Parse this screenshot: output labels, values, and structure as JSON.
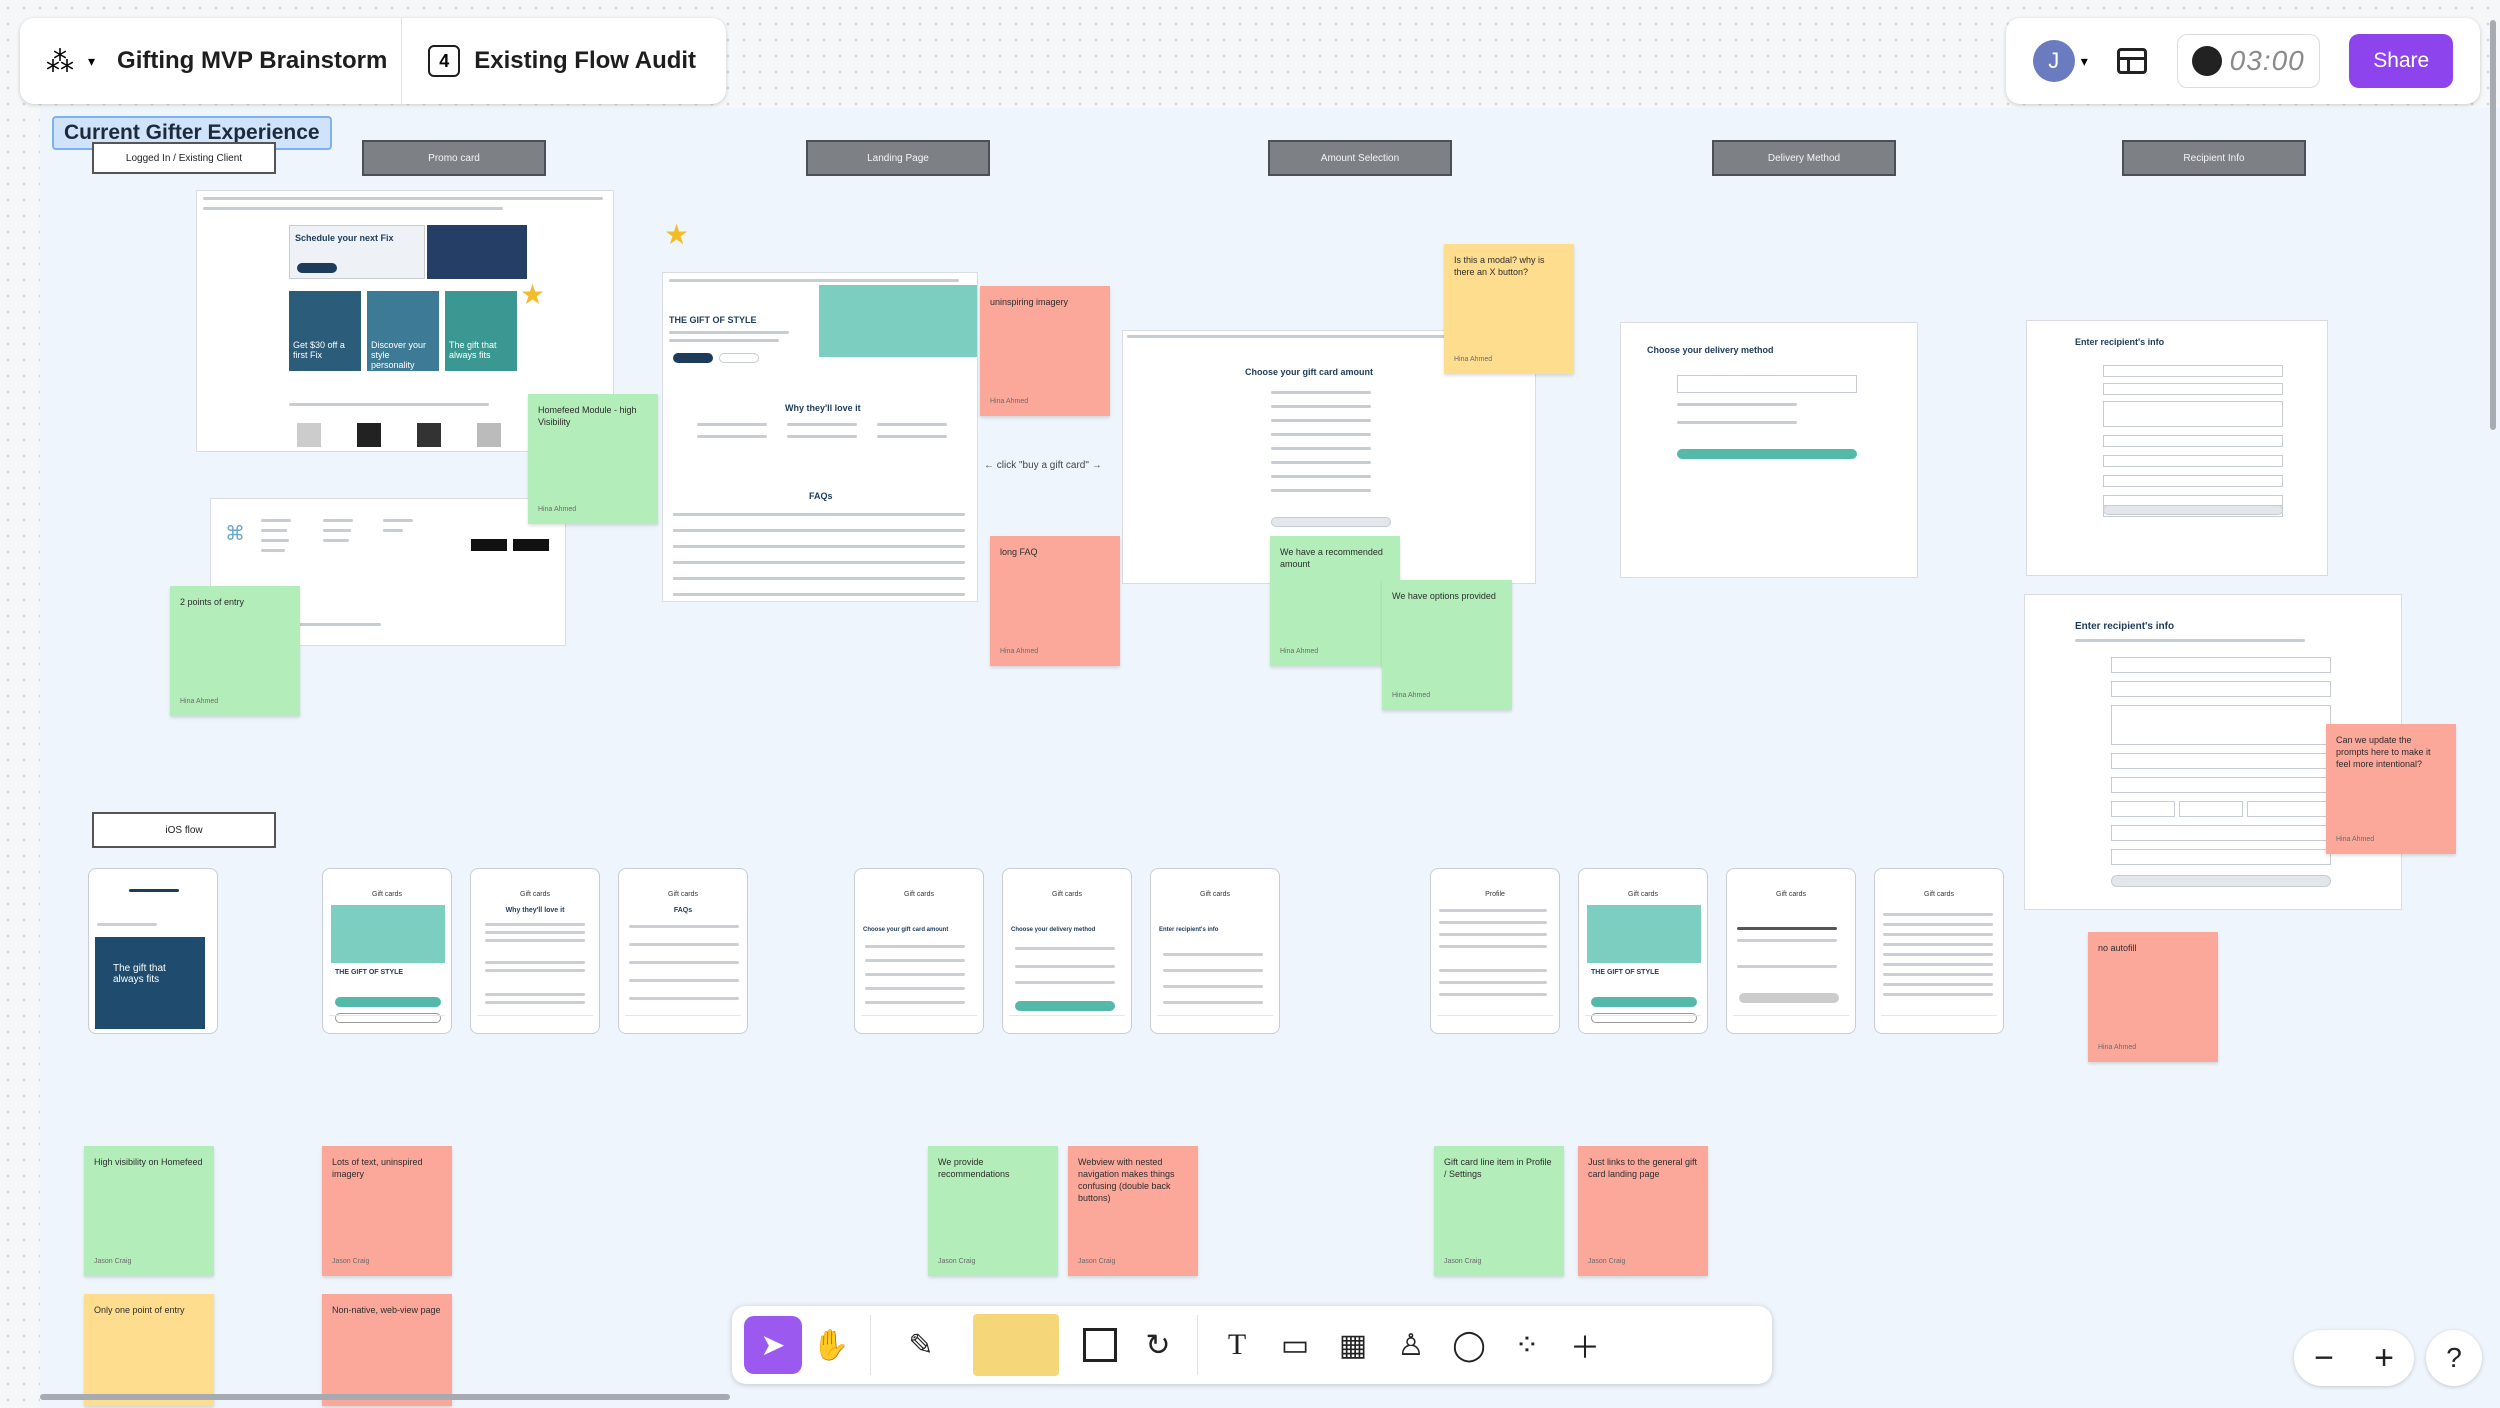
{
  "header": {
    "file_name": "Gifting MVP Brainstorm",
    "page_number": "4",
    "page_name": "Existing Flow Audit",
    "avatar_initial": "J",
    "timer": "03:00",
    "share_label": "Share"
  },
  "section": {
    "title": "Current Gifter Experience"
  },
  "columns": {
    "logged_in": "Logged In / Existing Client",
    "promo_card": "Promo card",
    "landing_page": "Landing Page",
    "amount_selection": "Amount Selection",
    "delivery_method": "Delivery Method",
    "recipient_info": "Recipient Info",
    "ios_flow": "iOS flow"
  },
  "screens": {
    "hero_title": "Schedule your next Fix",
    "gift_of_style": "THE GIFT OF STYLE",
    "why_love": "Why they'll love it",
    "faqs": "FAQs",
    "choose_amount": "Choose your gift card amount",
    "choose_delivery": "Choose your delivery method",
    "enter_recipient": "Enter recipient's info",
    "enter_recipient_2": "Enter recipient's info",
    "promo_1": "Get $30 off a first Fix",
    "promo_2": "Discover your style personality",
    "promo_3": "The gift that always fits",
    "ios_hero": "The gift that always fits",
    "ios_title_1": "Gift cards",
    "ios_title_2": "Profile",
    "ios_title_3": "Gift cards",
    "ios_title_4": "Gift cards"
  },
  "annotations": {
    "click_gift_card": "← click \"buy a gift card\" →"
  },
  "stickies": [
    {
      "text": "Homefeed Module - high Visibility",
      "author": "Hina Ahmed",
      "color": "green"
    },
    {
      "text": "2 points of entry",
      "author": "Hina Ahmed",
      "color": "green"
    },
    {
      "text": "uninspiring imagery",
      "author": "Hina Ahmed",
      "color": "red"
    },
    {
      "text": "long FAQ",
      "author": "Hina Ahmed",
      "color": "red"
    },
    {
      "text": "Is this a modal? why is there an X button?",
      "author": "Hina Ahmed",
      "color": "yellow"
    },
    {
      "text": "We have a recommended amount",
      "author": "Hina Ahmed",
      "color": "green"
    },
    {
      "text": "We have options provided",
      "author": "Hina Ahmed",
      "color": "green"
    },
    {
      "text": "Can we update the prompts here to make it feel more intentional?",
      "author": "Hina Ahmed",
      "color": "red"
    },
    {
      "text": "no autofill",
      "author": "Hina Ahmed",
      "color": "red"
    },
    {
      "text": "High visibility on Homefeed",
      "author": "Jason Craig",
      "color": "green"
    },
    {
      "text": "Lots of text, uninspired imagery",
      "author": "Jason Craig",
      "color": "red"
    },
    {
      "text": "We provide recommendations",
      "author": "Jason Craig",
      "color": "green"
    },
    {
      "text": "Webview with nested navigation makes things confusing (double back buttons)",
      "author": "Jason Craig",
      "color": "red"
    },
    {
      "text": "Gift card line item in Profile / Settings",
      "author": "Jason Craig",
      "color": "green"
    },
    {
      "text": "Just links to the general gift card landing page",
      "author": "Jason Craig",
      "color": "red"
    },
    {
      "text": "Only one point of entry",
      "author": "",
      "color": "yellow"
    },
    {
      "text": "Non-native, web-view page",
      "author": "",
      "color": "red"
    }
  ],
  "colors": {
    "accent": "#8e44ec",
    "sticky_green": "#b3edb9",
    "sticky_red": "#fba89b",
    "sticky_yellow": "#ffdd8e",
    "brand_teal": "#55b9a9"
  },
  "icons": {
    "app_menu": "figma-logo-icon",
    "layout": "layout-panel-icon",
    "tools": [
      "cursor-icon",
      "hand-icon",
      "pen-icon",
      "sticky-note-icon",
      "shape-icon",
      "connector-icon",
      "text-icon",
      "section-icon",
      "table-icon",
      "stamp-icon",
      "comment-icon",
      "widgets-icon",
      "add-icon"
    ]
  }
}
